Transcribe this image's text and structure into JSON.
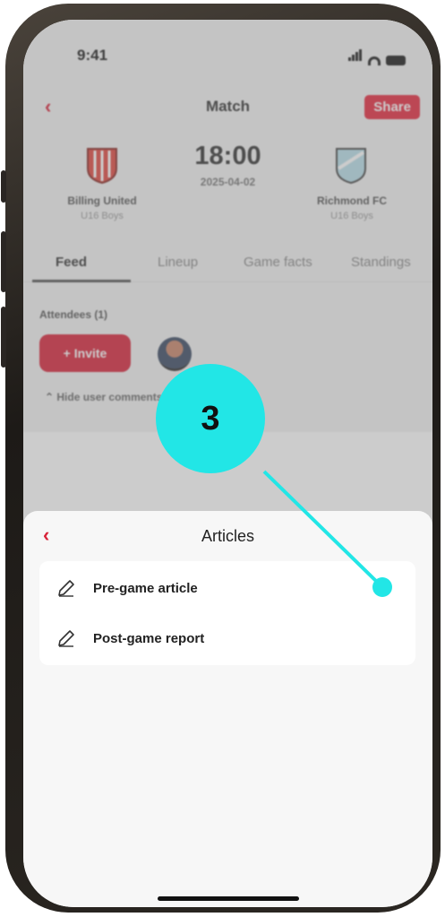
{
  "status_bar": {
    "time": "9:41"
  },
  "nav": {
    "back_icon": "chevron-left-icon",
    "title": "Match",
    "share_label": "Share"
  },
  "match": {
    "time": "18:00",
    "date": "2025-04-02",
    "home": {
      "name": "Billing United",
      "category": "U16 Boys",
      "crest_colors": [
        "#e1473f",
        "#ffffff"
      ]
    },
    "away": {
      "name": "Richmond FC",
      "category": "U16 Boys",
      "crest_colors": [
        "#b9dfea",
        "#555555"
      ]
    }
  },
  "tabs": [
    {
      "label": "Feed",
      "active": true
    },
    {
      "label": "Lineup",
      "active": false
    },
    {
      "label": "Game facts",
      "active": false
    },
    {
      "label": "Standings",
      "active": false
    }
  ],
  "feed": {
    "attendees_label": "Attendees (1)",
    "invite_label": "Invite",
    "hide_comments_label": "Hide user comments"
  },
  "sheet": {
    "title": "Articles",
    "items": [
      {
        "label": "Pre-game article",
        "icon": "pencil-icon"
      },
      {
        "label": "Post-game report",
        "icon": "pencil-icon"
      }
    ]
  },
  "annotation": {
    "step": "3",
    "color": "#22e6e6"
  },
  "colors": {
    "accent": "#e6293e",
    "sheet_bg": "#f7f7f7"
  }
}
